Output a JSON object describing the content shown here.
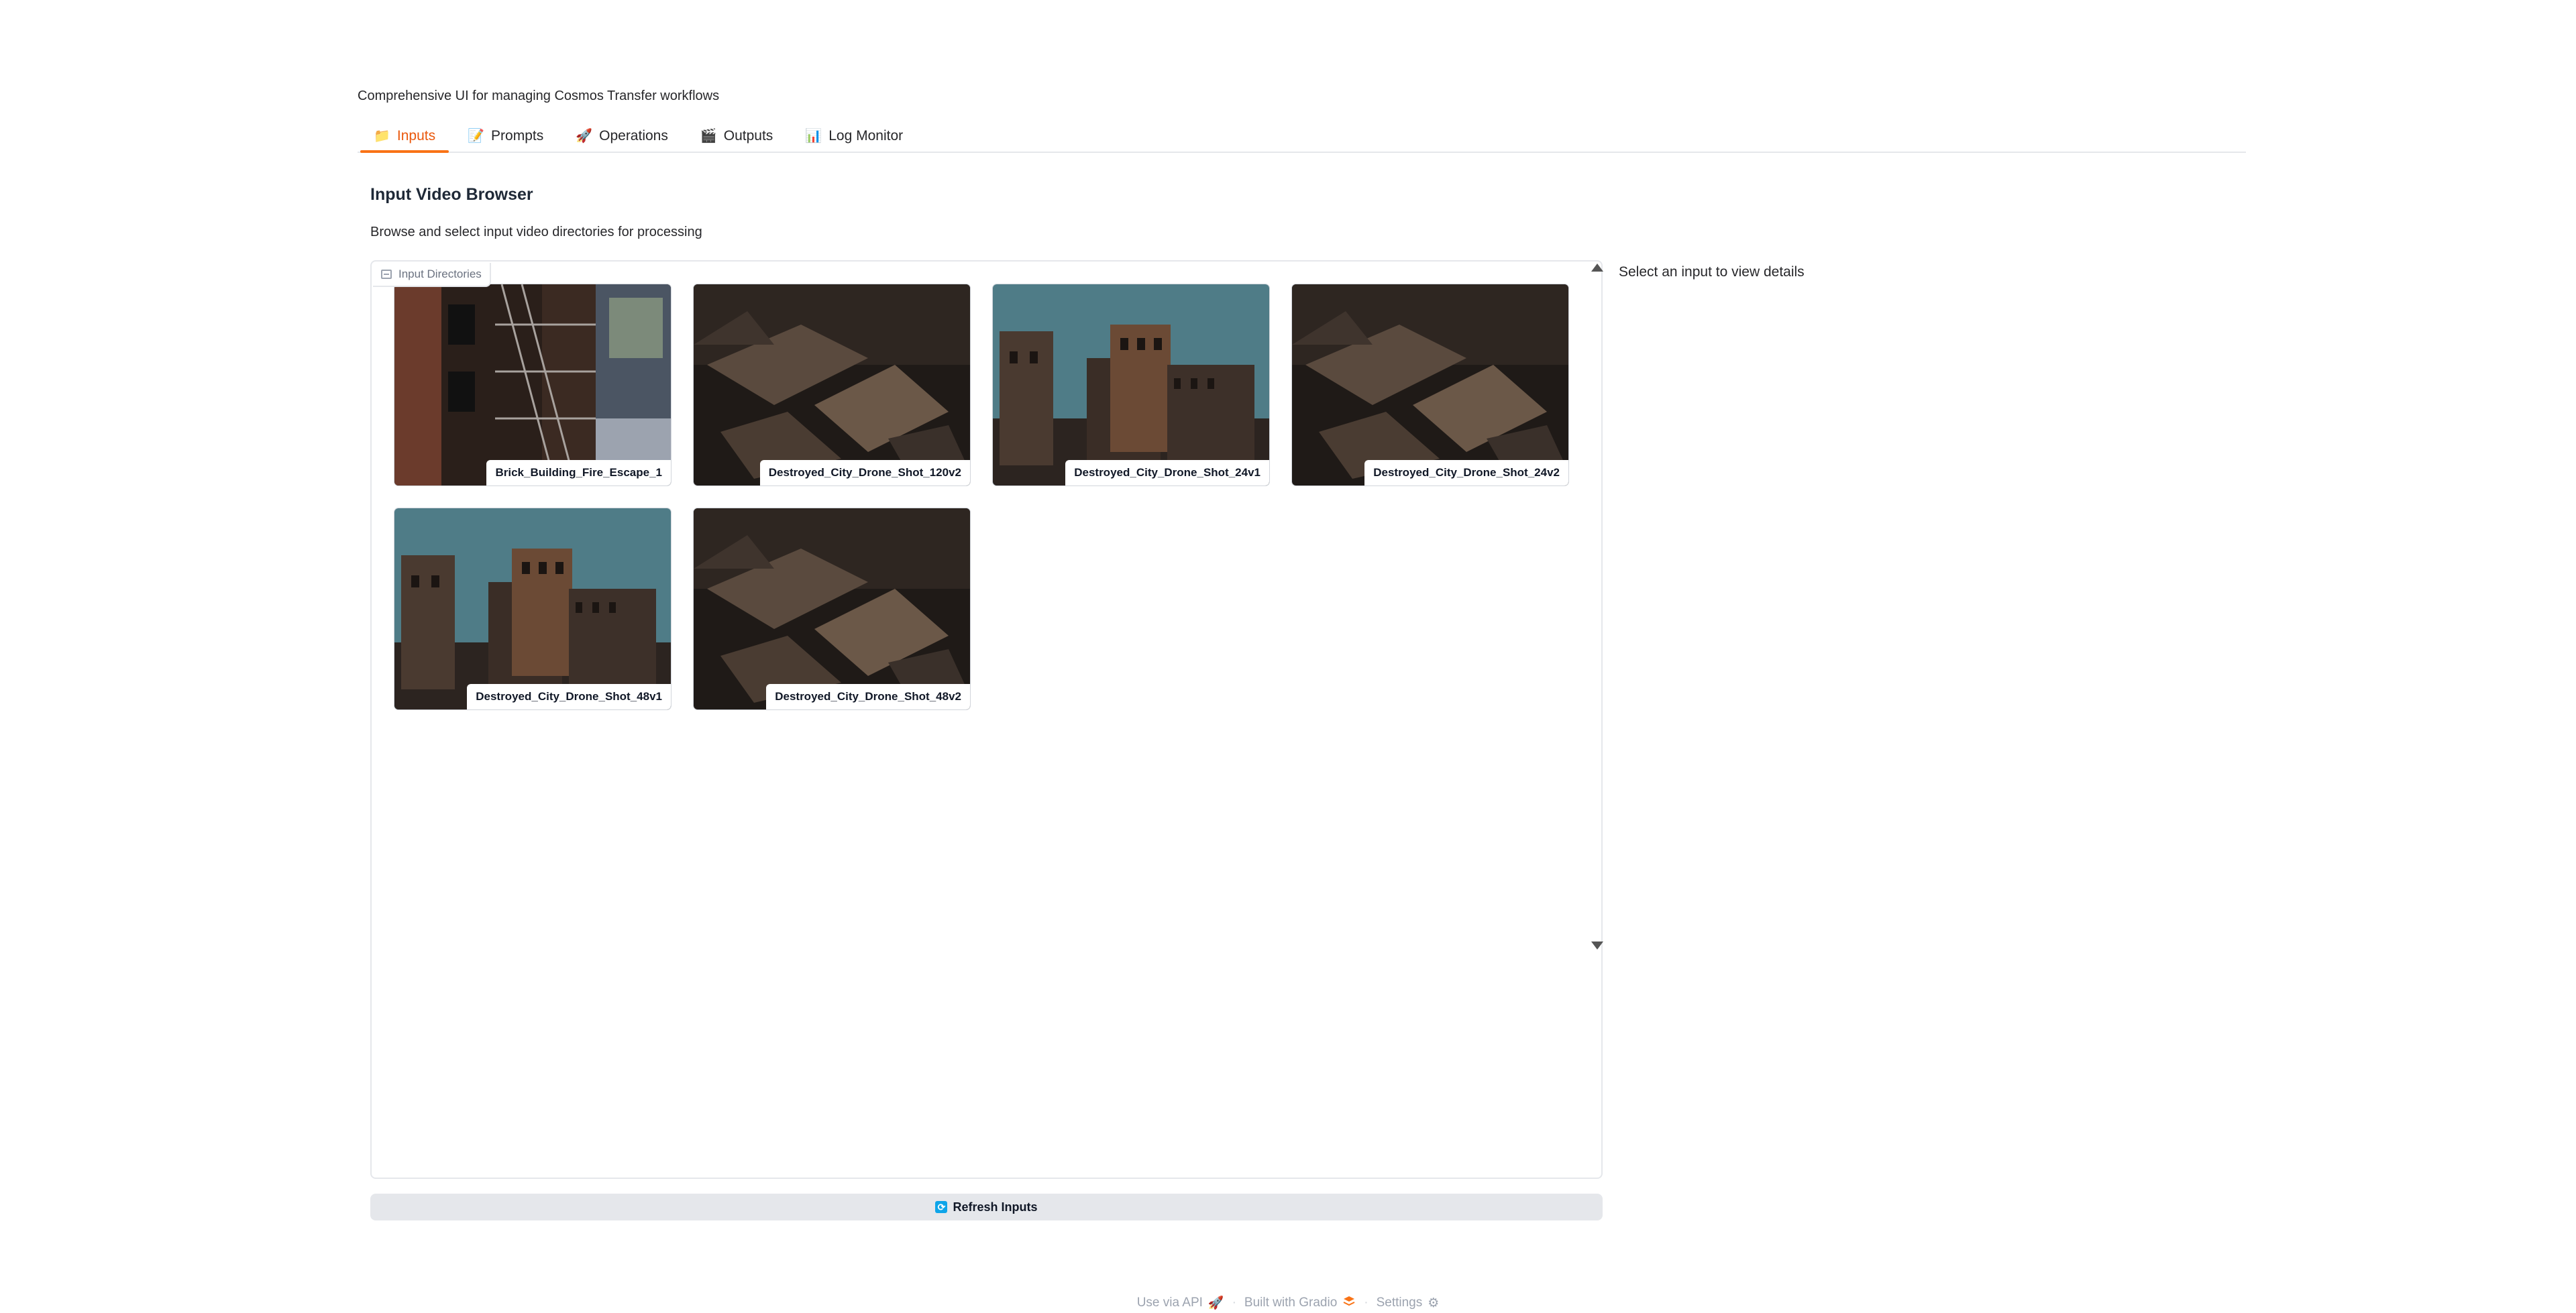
{
  "header": {
    "subtitle": "Comprehensive UI for managing Cosmos Transfer workflows"
  },
  "tabs": [
    {
      "label": "Inputs",
      "icon": "📁",
      "icon_name": "folder-icon",
      "active": true
    },
    {
      "label": "Prompts",
      "icon": "📝",
      "icon_name": "memo-icon",
      "active": false
    },
    {
      "label": "Operations",
      "icon": "🚀",
      "icon_name": "rocket-icon",
      "active": false
    },
    {
      "label": "Outputs",
      "icon": "🎬",
      "icon_name": "clapper-icon",
      "active": false
    },
    {
      "label": "Log Monitor",
      "icon": "📊",
      "icon_name": "chart-icon",
      "active": false
    }
  ],
  "section": {
    "title": "Input Video Browser",
    "description": "Browse and select input video directories for processing"
  },
  "gallery": {
    "label": "Input Directories",
    "items": [
      {
        "caption": "Brick_Building_Fire_Escape_1",
        "scene": "brick"
      },
      {
        "caption": "Destroyed_City_Drone_Shot_120v2",
        "scene": "rubble"
      },
      {
        "caption": "Destroyed_City_Drone_Shot_24v1",
        "scene": "city"
      },
      {
        "caption": "Destroyed_City_Drone_Shot_24v2",
        "scene": "rubble"
      },
      {
        "caption": "Destroyed_City_Drone_Shot_48v1",
        "scene": "city"
      },
      {
        "caption": "Destroyed_City_Drone_Shot_48v2",
        "scene": "rubble"
      }
    ]
  },
  "details": {
    "placeholder": "Select an input to view details"
  },
  "actions": {
    "refresh_label": "Refresh Inputs"
  },
  "footer": {
    "api_label": "Use via API",
    "built_label": "Built with Gradio",
    "settings_label": "Settings"
  },
  "colors": {
    "accent": "#f97316",
    "active_tab_text": "#ea580c",
    "button_bg": "#e5e7eb"
  }
}
